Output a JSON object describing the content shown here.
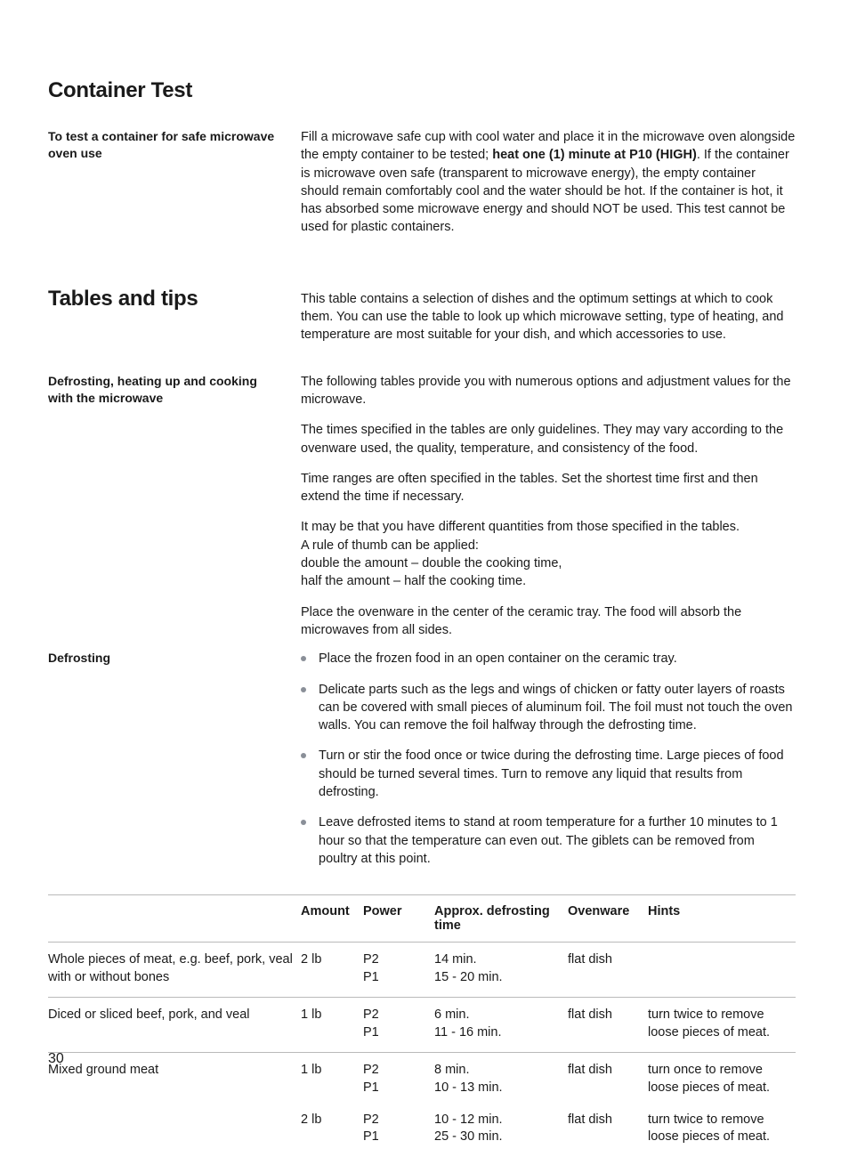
{
  "page_number": "30",
  "container_test": {
    "title": "Container Test",
    "side_heading": "To test a container for safe microwave oven use",
    "body_pre": "Fill a microwave safe cup with cool water and place it in the microwave oven alongside the empty container to be tested; ",
    "body_bold": "heat one (1) minute at P10 (HIGH)",
    "body_post": ". If the container is microwave oven safe (transparent to microwave energy), the empty container should remain comfortably cool and the water should be hot. If the container is hot, it has absorbed some microwave energy and should NOT be used. This test cannot be used for plastic containers."
  },
  "tables_tips": {
    "title": "Tables and tips",
    "intro": "This table contains a selection of dishes and the optimum settings at which to cook them. You can use the table to look up which microwave setting, type of heating, and temperature are most suitable for your dish, and which accessories to use."
  },
  "defrost_heat_cook": {
    "side_heading": "Defrosting, heating up and cooking with the microwave",
    "p1": "The following tables provide you with numerous options and adjustment values for the microwave.",
    "p2": "The times specified in the tables are only guidelines. They may vary according to the ovenware used, the quality, temperature, and consistency of the food.",
    "p3": "Time ranges are often specified in the tables. Set the shortest time first and then extend the time if necessary.",
    "p4": "It may be that you have different quantities from those specified in the tables.\nA rule of thumb can be applied:\ndouble the amount   – double the cooking time,\nhalf the amount          – half the cooking time.",
    "p5": "Place the ovenware in the center of the ceramic tray. The food will absorb the microwaves from all sides."
  },
  "defrosting": {
    "side_heading": "Defrosting",
    "bullets": [
      "Place the frozen food in an open container on the ceramic tray.",
      "Delicate parts such as the legs and wings of chicken or fatty outer layers of roasts can be covered with small pieces of aluminum foil. The foil must not touch the oven walls. You can remove the foil halfway through the defrosting time.",
      "Turn or stir the food once or twice during the defrosting time. Large pieces of food should be turned several times. Turn to remove any liquid that results from defrosting.",
      "Leave defrosted items to stand at room temperature for a further 10 minutes to 1 hour so that the temperature can even out. The giblets can be removed from poultry at this point."
    ]
  },
  "table": {
    "headers": {
      "item": "",
      "amount": "Amount",
      "power": "Power",
      "time": "Approx. defrosting time",
      "ovenware": "Ovenware",
      "hints": "Hints"
    },
    "rows": [
      {
        "item": "Whole pieces of meat, e.g. beef, pork, veal with or without bones",
        "amount": "2 lb",
        "power": "P2\nP1",
        "time": "14 min.\n15 - 20 min.",
        "ovenware": "flat dish",
        "hints": "",
        "divider": true
      },
      {
        "item": "Diced or sliced beef, pork, and veal",
        "amount": "1 lb",
        "power": "P2\nP1",
        "time": "6 min.\n11 - 16 min.",
        "ovenware": "flat dish",
        "hints": "turn twice to remove loose pieces of meat.",
        "divider": true
      },
      {
        "item": "Mixed ground meat",
        "amount": "1 lb",
        "power": "P2\nP1",
        "time": "8 min.\n10 - 13 min.",
        "ovenware": "flat dish",
        "hints": "turn once to remove loose pieces of meat.",
        "divider": true
      },
      {
        "item": "",
        "amount": "2 lb",
        "power": "P2\nP1",
        "time": "10 - 12 min.\n25 - 30 min.",
        "ovenware": "flat dish",
        "hints": "turn twice to remove loose pieces of meat.",
        "divider": false
      }
    ]
  }
}
